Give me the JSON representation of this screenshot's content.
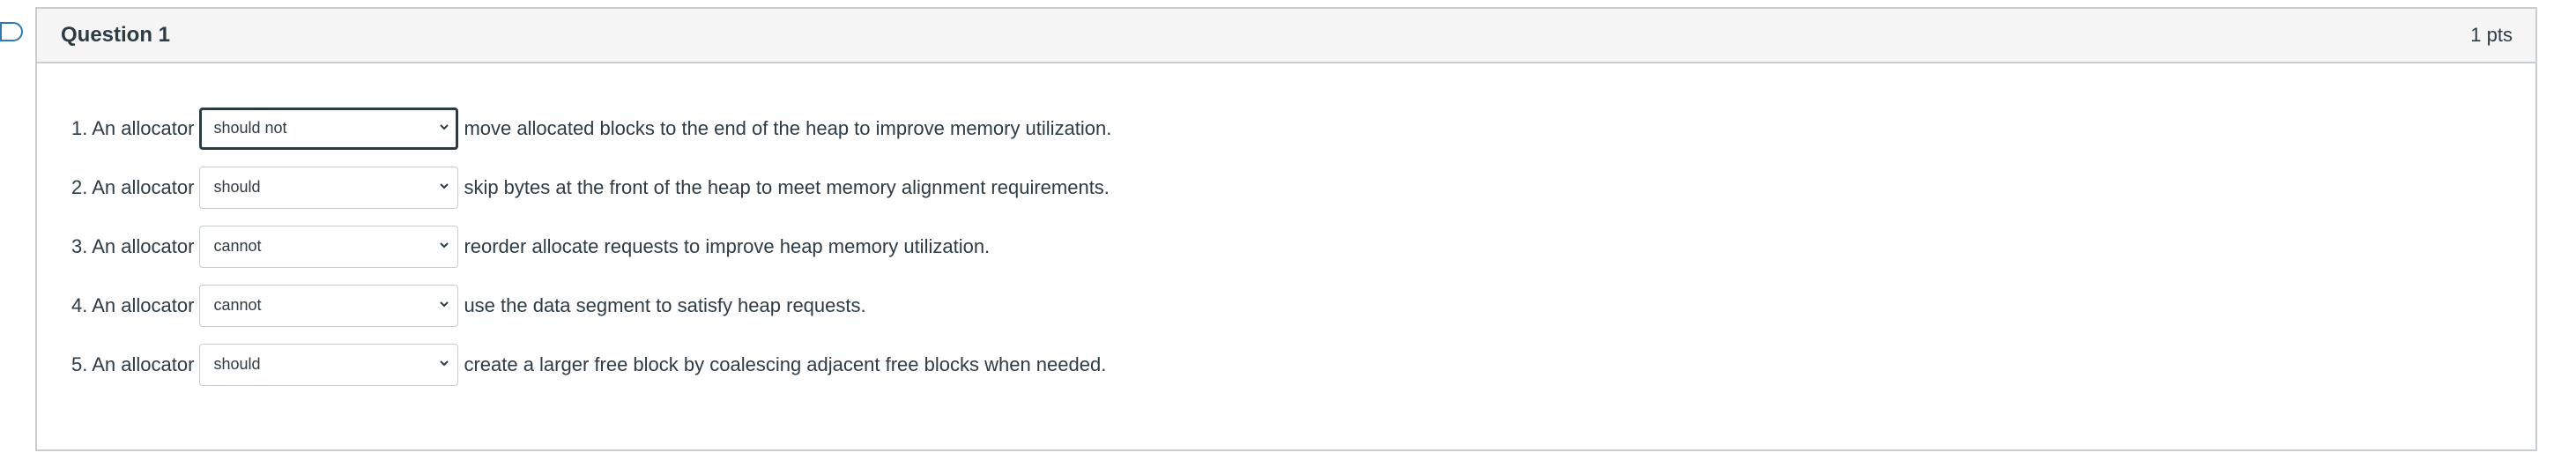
{
  "question": {
    "title": "Question 1",
    "points": "1 pts",
    "items": [
      {
        "prefix": "1. An allocator",
        "selected": "should not",
        "suffix": "move allocated blocks to the end of the heap to improve memory utilization."
      },
      {
        "prefix": "2. An allocator",
        "selected": "should",
        "suffix": "skip bytes at the front of the heap to meet memory alignment requirements."
      },
      {
        "prefix": "3. An allocator",
        "selected": "cannot",
        "suffix": "reorder allocate requests to improve heap memory utilization."
      },
      {
        "prefix": "4. An allocator",
        "selected": "cannot",
        "suffix": "use the data segment to satisfy heap requests."
      },
      {
        "prefix": "5. An allocator",
        "selected": "should",
        "suffix": "create a larger free block by coalescing adjacent free blocks when needed."
      }
    ]
  },
  "icons": {
    "bookmark": "bookmark-icon",
    "dropdown": "chevron-down-icon"
  },
  "colors": {
    "text": "#2d3b45",
    "border": "#c7cdd1",
    "header_bg": "#f5f5f5"
  }
}
